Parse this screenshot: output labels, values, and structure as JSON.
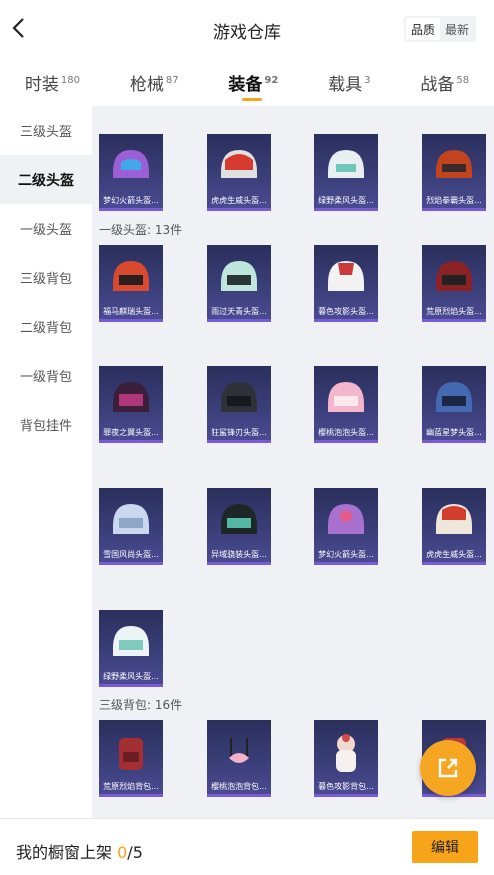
{
  "header": {
    "title": "游戏仓库",
    "sort": [
      "品质",
      "最新"
    ]
  },
  "tabs": [
    {
      "label": "时装",
      "count": "180"
    },
    {
      "label": "枪械",
      "count": "87"
    },
    {
      "label": "装备",
      "count": "92"
    },
    {
      "label": "载具",
      "count": "3"
    },
    {
      "label": "战备",
      "count": "58"
    }
  ],
  "sidebar": [
    "三级头盔",
    "二级头盔",
    "一级头盔",
    "三级背包",
    "二级背包",
    "一级背包",
    "背包挂件"
  ],
  "sections": {
    "helmet1": "一级头盔: 13件",
    "backpack3": "三级背包: 16件"
  },
  "items": {
    "helmet2": [
      "梦幻火箭头盔...",
      "虎虎生威头盔...",
      "绿野柔风头盔...",
      "烈焰拳霸头盔..."
    ],
    "helmet1": [
      "福马麒瑞头盔...",
      "雨过天青头盔...",
      "暮色攻影头盔...",
      "荒原烈焰头盔...",
      "罪夜之翼头盔...",
      "狂鲨锋刃头盔...",
      "樱桃泡泡头盔...",
      "幽蓝星梦头盔...",
      "雪国风尚头盔...",
      "异域骁装头盔...",
      "梦幻火箭头盔...",
      "虎虎生威头盔...",
      "绿野柔风头盔..."
    ],
    "backpack3": [
      "荒原烈焰背包...",
      "樱桃泡泡背包...",
      "暮色攻影背包...",
      ""
    ]
  },
  "footer": {
    "label": "我的橱窗上架",
    "current": "0",
    "total": "/5",
    "edit": "编辑"
  },
  "colors": {
    "accent": "#f7a41a",
    "content_bg": "#eff1f4",
    "card_bg": "#2f3368"
  },
  "icons": {
    "back": "chevron-left-icon",
    "share": "share-out-icon"
  }
}
